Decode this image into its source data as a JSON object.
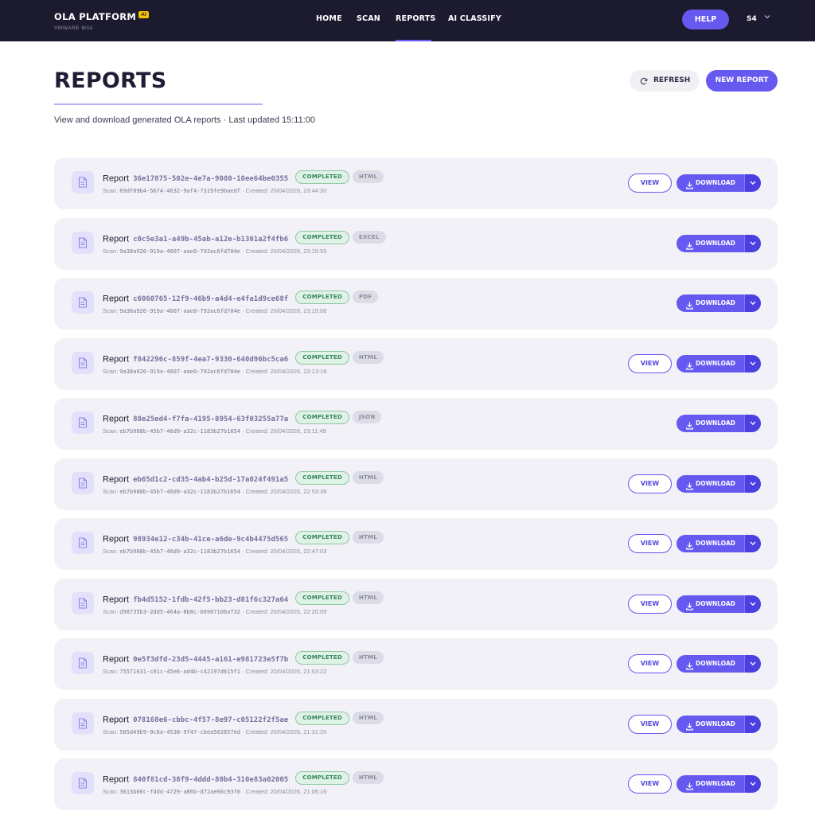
{
  "nav": {
    "brand": "OLA PLATFORM",
    "brand_badge": "AI",
    "brand_sub": "VMWARE M3A",
    "links": [
      {
        "label": "HOME",
        "active": false
      },
      {
        "label": "SCAN",
        "active": false
      },
      {
        "label": "REPORTS",
        "active": true
      },
      {
        "label": "AI CLASSIFY",
        "active": false
      }
    ],
    "help_label": "HELP",
    "user_initials": "S4"
  },
  "header": {
    "title": "REPORTS",
    "subtitle": "View and download generated OLA reports · Last updated 15:11:00",
    "refresh_label": "REFRESH",
    "new_report_label": "NEW REPORT"
  },
  "labels": {
    "report_word": "Report",
    "scan_prefix": "Scan: ",
    "created_prefix": " · Created: ",
    "view": "VIEW",
    "download": "DOWNLOAD"
  },
  "colors": {
    "nav_bg": "#1c1a2e",
    "accent": "#6559f0",
    "status_completed": "#35865a"
  },
  "reports": [
    {
      "id": "36e17875-502e-4e7a-9080-10ee64be0355",
      "status": "COMPLETED",
      "format": "HTML",
      "scan": "69df09b4-56f4-4632-9af4-7319fe9baedf",
      "created": "20/04/2026, 23:44:30",
      "viewable": true
    },
    {
      "id": "c0c5e3a1-a49b-45ab-a12e-b1301a2f4fb6",
      "status": "COMPLETED",
      "format": "EXCEL",
      "scan": "9a38a926-919a-4607-aae0-792ac6fd704e",
      "created": "20/04/2026, 23:15:55",
      "viewable": false
    },
    {
      "id": "c6060765-12f9-46b9-a4d4-e4fa1d9ce68f",
      "status": "COMPLETED",
      "format": "PDF",
      "scan": "9a38a926-919a-4607-aae0-792ac6fd704e",
      "created": "20/04/2026, 23:15:06",
      "viewable": false
    },
    {
      "id": "f842296c-859f-4ea7-9330-640d96bc5ca6",
      "status": "COMPLETED",
      "format": "HTML",
      "scan": "9a38a926-919a-4607-aae0-792ac6fd704e",
      "created": "20/04/2026, 23:13:18",
      "viewable": true
    },
    {
      "id": "88e25ed4-f7fa-4195-8954-63f03255a77a",
      "status": "COMPLETED",
      "format": "JSON",
      "scan": "eb7b988b-45b7-46d9-a32c-1183b27b1654",
      "created": "20/04/2026, 23:11:49",
      "viewable": false
    },
    {
      "id": "eb65d1c2-cd35-4ab4-b25d-17a024f491a5",
      "status": "COMPLETED",
      "format": "HTML",
      "scan": "eb7b988b-45b7-46d9-a32c-1183b27b1654",
      "created": "20/04/2026, 22:53:38",
      "viewable": true
    },
    {
      "id": "98934e12-c34b-41ce-a6de-9c4b4475d565",
      "status": "COMPLETED",
      "format": "HTML",
      "scan": "eb7b988b-45b7-46d9-a32c-1183b27b1654",
      "created": "20/04/2026, 22:47:03",
      "viewable": true
    },
    {
      "id": "fb4d5152-1fdb-42f5-bb23-d81f6c327a64",
      "status": "COMPLETED",
      "format": "HTML",
      "scan": "d98735b3-2dd5-464a-8b8c-b6907106af32",
      "created": "20/04/2026, 22:20:09",
      "viewable": true
    },
    {
      "id": "0e5f3dfd-23d5-4445-a161-e981723e5f7b",
      "status": "COMPLETED",
      "format": "HTML",
      "scan": "75571631-c01c-45e6-ad4b-c42197d615f1",
      "created": "20/04/2026, 21:53:22",
      "viewable": true
    },
    {
      "id": "078168e6-cbbc-4f57-8e97-c05122f2f5ae",
      "status": "COMPLETED",
      "format": "HTML",
      "scan": "585d49b9-9c6a-4538-9f47-cbea502857ed",
      "created": "20/04/2026, 21:31:20",
      "viewable": true
    },
    {
      "id": "840f81cd-38f9-4ddd-80b4-310e83a02005",
      "status": "COMPLETED",
      "format": "HTML",
      "scan": "3613b60c-fddd-4729-a86b-d72ae66c93f0",
      "created": "20/04/2026, 21:06:16",
      "viewable": true
    }
  ]
}
